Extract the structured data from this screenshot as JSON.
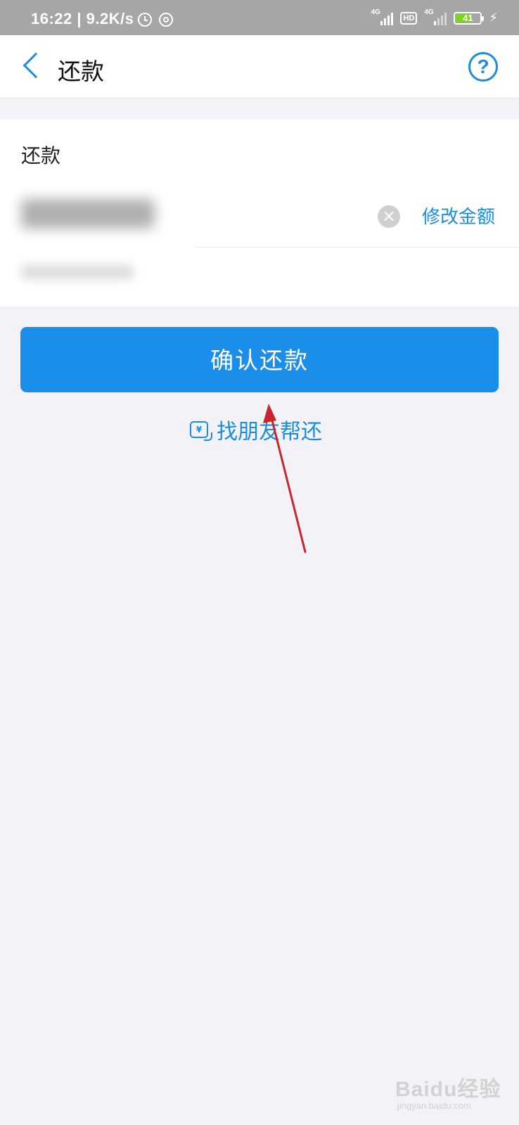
{
  "status_bar": {
    "time_speed": "16:22 | 9.2K/s",
    "net_tag_1": "4G",
    "hd_label": "HD",
    "net_tag_2": "4G",
    "battery_level": "41"
  },
  "nav": {
    "title": "还款"
  },
  "card": {
    "label": "还款",
    "clear_symbol": "×",
    "edit_amount_label": "修改金额"
  },
  "actions": {
    "confirm_label": "确认还款",
    "friend_help_label": "找朋友帮还",
    "friend_icon_glyph": "¥"
  },
  "watermark": {
    "brand": "Baidu经验",
    "url": "jingyan.baidu.com"
  },
  "colors": {
    "accent": "#1a8de3",
    "primary_button": "#1a8ee8",
    "background": "#f2f2f7",
    "annotation_arrow": "#c8262c",
    "battery_fill": "#7ed321"
  }
}
